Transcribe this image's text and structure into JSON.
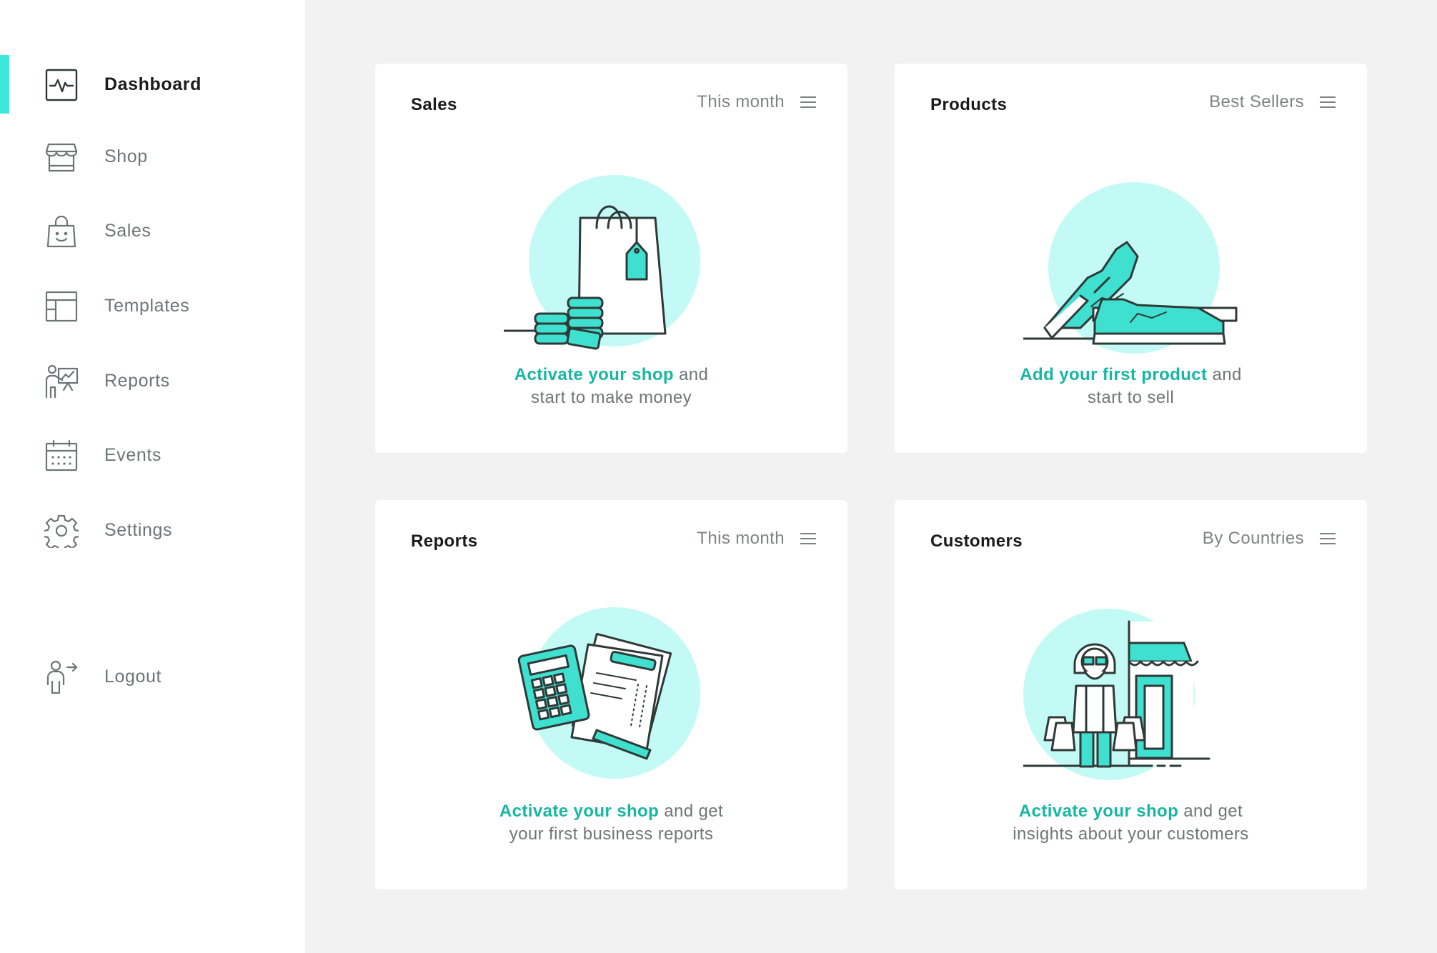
{
  "colors": {
    "accent": "#3be8d9",
    "link": "#17b6a2",
    "illustration_fill": "#c4faf5"
  },
  "sidebar": {
    "items": [
      {
        "label": "Dashboard",
        "icon": "activity-icon",
        "active": true
      },
      {
        "label": "Shop",
        "icon": "storefront-icon",
        "active": false
      },
      {
        "label": "Sales",
        "icon": "shopping-bag-icon",
        "active": false
      },
      {
        "label": "Templates",
        "icon": "layout-icon",
        "active": false
      },
      {
        "label": "Reports",
        "icon": "presentation-icon",
        "active": false
      },
      {
        "label": "Events",
        "icon": "calendar-icon",
        "active": false
      },
      {
        "label": "Settings",
        "icon": "gear-icon",
        "active": false
      }
    ],
    "logout": {
      "label": "Logout",
      "icon": "logout-icon"
    }
  },
  "cards": {
    "sales": {
      "title": "Sales",
      "filter": "This month",
      "link": "Activate your shop",
      "text1": " and",
      "text2": "start to make money",
      "illustration": "shopping-bag-coins-icon"
    },
    "products": {
      "title": "Products",
      "filter": "Best Sellers",
      "link": "Add your first product",
      "text1": " and",
      "text2": "start to sell",
      "illustration": "sneakers-icon"
    },
    "reports": {
      "title": "Reports",
      "filter": "This month",
      "link": "Activate your shop",
      "text1": " and get",
      "text2": "your first business reports",
      "illustration": "calculator-documents-icon"
    },
    "customers": {
      "title": "Customers",
      "filter": "By Countries",
      "link": "Activate your shop",
      "text1": " and get",
      "text2": "insights about your customers",
      "illustration": "shopper-storefront-icon"
    }
  }
}
